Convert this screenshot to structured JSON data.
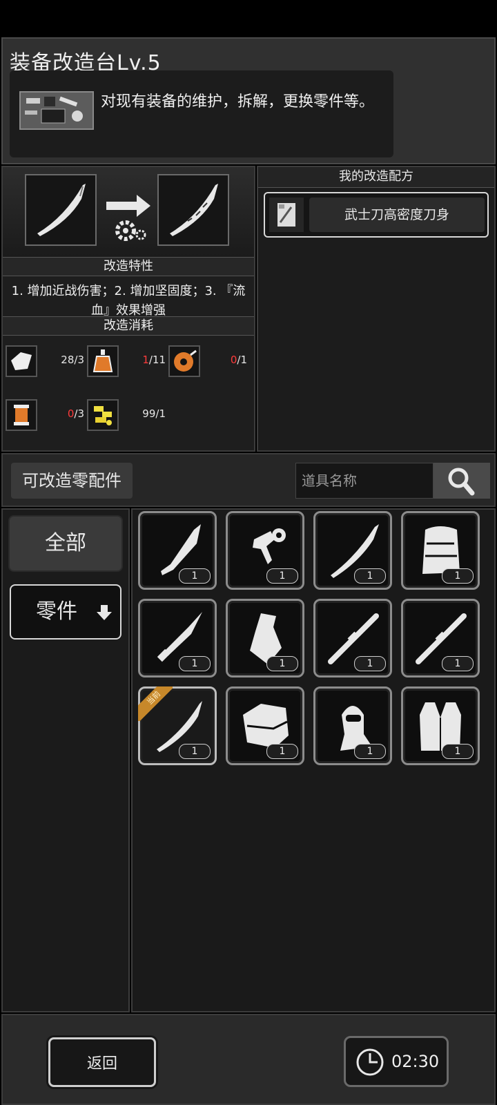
{
  "header": {
    "title": "装备改造台Lv.5",
    "description": "对现有装备的维护，拆解，更换零件等。"
  },
  "upgrade": {
    "traits_heading": "改造特性",
    "traits_text": "1. 增加近战伤害；2. 增加坚固度；3. 『流血』效果增强",
    "cost_heading": "改造消耗",
    "materials": [
      {
        "icon": "cloth-icon",
        "have": "28",
        "need": "/3",
        "short": false
      },
      {
        "icon": "oil-bottle-icon",
        "have": "1",
        "need": "/11",
        "short": true
      },
      {
        "icon": "tape-roll-icon",
        "have": "0",
        "need": "/1",
        "short": true
      },
      {
        "icon": "thread-spool-icon",
        "have": "0",
        "need": "/3",
        "short": true
      },
      {
        "icon": "scrap-parts-icon",
        "have": "99",
        "need": "/1",
        "short": false
      }
    ]
  },
  "recipes": {
    "heading": "我的改造配方",
    "items": [
      {
        "label": "武士刀高密度刀身"
      }
    ]
  },
  "parts": {
    "title": "可改造零配件",
    "search_placeholder": "道具名称",
    "categories": {
      "all": "全部",
      "parts": "零件"
    },
    "current_badge": "当前",
    "items": [
      {
        "icon": "machete-blade-icon",
        "qty": "1"
      },
      {
        "icon": "trigger-part-icon",
        "qty": "1"
      },
      {
        "icon": "curved-blade-icon",
        "qty": "1"
      },
      {
        "icon": "backpack-icon",
        "qty": "1"
      },
      {
        "icon": "knife-blade-icon",
        "qty": "1"
      },
      {
        "icon": "axe-head-icon",
        "qty": "1"
      },
      {
        "icon": "rod-part-icon",
        "qty": "1"
      },
      {
        "icon": "rod-part-icon",
        "qty": "1"
      },
      {
        "icon": "katana-blade-icon",
        "qty": "1"
      },
      {
        "icon": "armor-pad-icon",
        "qty": "1"
      },
      {
        "icon": "balaclava-icon",
        "qty": "1"
      },
      {
        "icon": "vest-icon",
        "qty": "1"
      }
    ]
  },
  "footer": {
    "back_label": "返回",
    "time": "02:30"
  },
  "colors": {
    "shortage": "#ff3b3b",
    "badge": "#c7882a"
  }
}
